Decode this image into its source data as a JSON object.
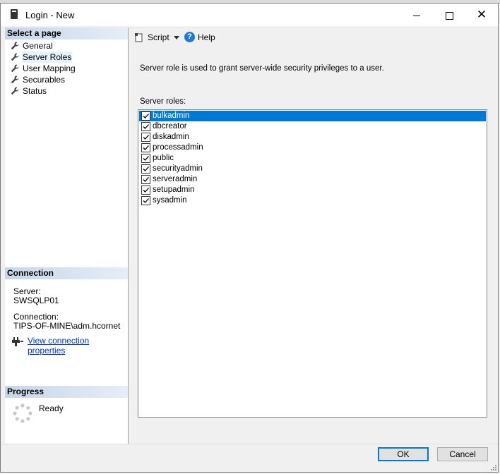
{
  "window": {
    "title": "Login - New",
    "controls": {
      "minimize": "minimize",
      "maximize": "maximize",
      "close": "✕"
    }
  },
  "sidebar": {
    "select_page_header": "Select a page",
    "items": [
      {
        "label": "General",
        "icon": "wrench-icon"
      },
      {
        "label": "Server Roles",
        "icon": "wrench-icon",
        "selected": true
      },
      {
        "label": "User Mapping",
        "icon": "wrench-icon"
      },
      {
        "label": "Securables",
        "icon": "wrench-icon"
      },
      {
        "label": "Status",
        "icon": "wrench-icon"
      }
    ],
    "connection": {
      "header": "Connection",
      "server_label": "Server:",
      "server_value": "SWSQLP01",
      "connection_label": "Connection:",
      "connection_value": "TIPS-OF-MINE\\adm.hcornet",
      "link": "View connection properties"
    },
    "progress": {
      "header": "Progress",
      "status": "Ready"
    }
  },
  "toolbar": {
    "script_label": "Script",
    "help_label": "Help"
  },
  "main": {
    "description": "Server role is used to grant server-wide security privileges to a user.",
    "roles_label": "Server roles:",
    "roles": [
      {
        "name": "bulkadmin",
        "checked": true,
        "selected": true
      },
      {
        "name": "dbcreator",
        "checked": true
      },
      {
        "name": "diskadmin",
        "checked": true
      },
      {
        "name": "processadmin",
        "checked": true
      },
      {
        "name": "public",
        "checked": true
      },
      {
        "name": "securityadmin",
        "checked": true
      },
      {
        "name": "serveradmin",
        "checked": true
      },
      {
        "name": "setupadmin",
        "checked": true
      },
      {
        "name": "sysadmin",
        "checked": true
      }
    ]
  },
  "footer": {
    "ok_label": "OK",
    "cancel_label": "Cancel"
  },
  "colors": {
    "selection": "#0078d7",
    "link": "#0033cc",
    "section_header": "#c6d6e8"
  }
}
